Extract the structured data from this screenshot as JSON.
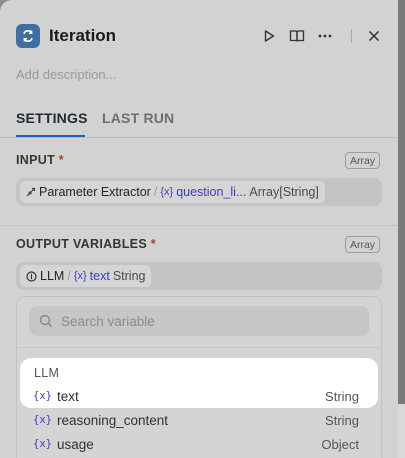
{
  "header": {
    "title": "Iteration"
  },
  "description": {
    "placeholder": "Add description..."
  },
  "tabs": [
    {
      "label": "SETTINGS",
      "active": true
    },
    {
      "label": "LAST RUN",
      "active": false
    }
  ],
  "input_section": {
    "label": "INPUT",
    "required_mark": "*",
    "type_badge": "Array",
    "selected": {
      "node": "Parameter Extractor",
      "separator": "/",
      "variable": "question_li...",
      "type": "Array[String]"
    }
  },
  "output_section": {
    "label": "OUTPUT VARIABLES",
    "required_mark": "*",
    "type_badge": "Array",
    "selected": {
      "node": "LLM",
      "separator": "/",
      "variable": "text",
      "type": "String"
    }
  },
  "dropdown": {
    "search_placeholder": "Search variable",
    "group_label": "LLM",
    "items": [
      {
        "icon": "{x}",
        "name": "text",
        "type": "String",
        "highlighted": true
      },
      {
        "icon": "{x}",
        "name": "reasoning_content",
        "type": "String",
        "highlighted": false
      },
      {
        "icon": "{x}",
        "name": "usage",
        "type": "Object",
        "highlighted": false
      }
    ]
  },
  "colors": {
    "accent": "#1f5fbf",
    "variable": "#3d3bbf",
    "required": "#b53b2e",
    "app_icon": "#3f6fa0"
  }
}
